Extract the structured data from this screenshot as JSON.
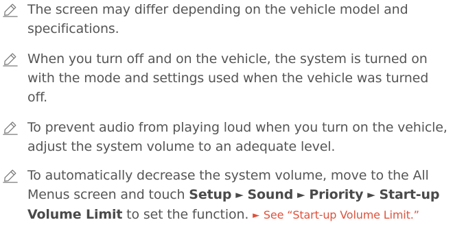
{
  "notes": [
    {
      "icon": "pencil-icon",
      "text": "The screen may differ depending on the vehicle model and specifications."
    },
    {
      "icon": "pencil-icon",
      "text": "When you turn off and on the vehicle, the system is turned on with the mode and settings used when the vehicle was turned off."
    },
    {
      "icon": "pencil-icon",
      "text": "To prevent audio from playing loud when you turn on the vehicle, adjust the system volume to an adequate level."
    },
    {
      "icon": "pencil-icon",
      "text_before": "To automatically decrease the system volume, move to the All Menus screen and touch ",
      "path": [
        "Setup",
        "Sound",
        "Priority",
        "Start-up Volume Limit"
      ],
      "text_after": " to set the function. ",
      "arrow_glyph": "►",
      "reference": "See “Start-up Volume Limit.”"
    }
  ],
  "colors": {
    "text": "#555555",
    "bold": "#4a4a4a",
    "reference": "#e0503a",
    "icon": "#7a7a7a"
  }
}
